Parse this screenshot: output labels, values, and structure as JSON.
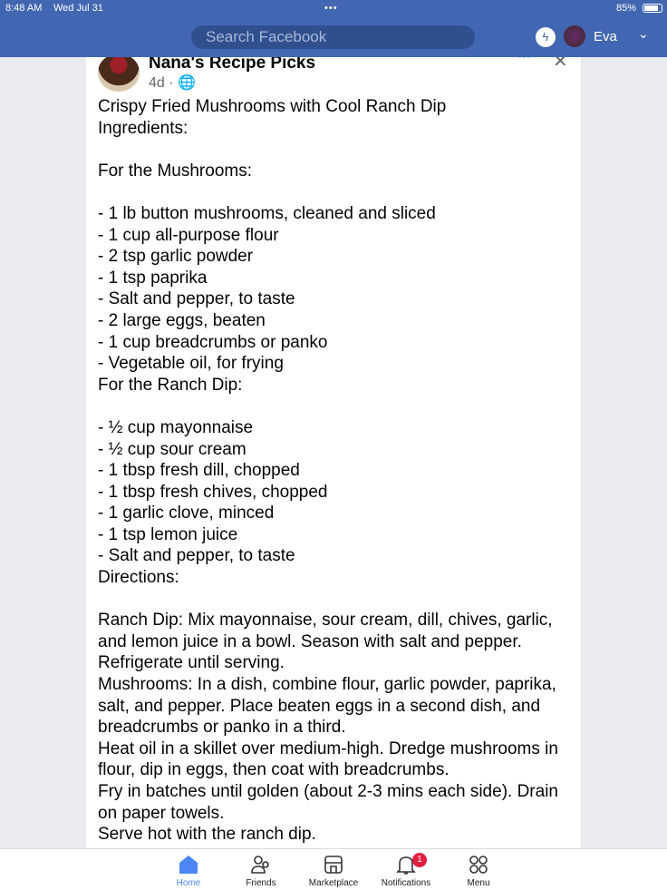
{
  "status": {
    "time": "8:48 AM",
    "date": "Wed Jul 31",
    "battery": "85%"
  },
  "header": {
    "search_placeholder": "Search Facebook",
    "user": "Eva"
  },
  "post": {
    "page_name": "Nana's Recipe Picks",
    "age": "4d ·",
    "lines": [
      "Crispy Fried Mushrooms with Cool Ranch Dip",
      "Ingredients:",
      "",
      "For the Mushrooms:",
      "",
      "- 1 lb button mushrooms, cleaned and sliced",
      "- 1 cup all-purpose flour",
      "- 2 tsp garlic powder",
      "- 1 tsp paprika",
      "- Salt and pepper, to taste",
      "- 2 large eggs, beaten",
      "- 1 cup breadcrumbs or panko",
      "- Vegetable oil, for frying",
      "For the Ranch Dip:",
      "",
      "- ½ cup mayonnaise",
      "- ½ cup sour cream",
      "- 1 tbsp fresh dill, chopped",
      "- 1 tbsp fresh chives, chopped",
      "- 1 garlic clove, minced",
      "- 1 tsp lemon juice",
      "- Salt and pepper, to taste",
      "Directions:",
      "",
      "Ranch Dip: Mix mayonnaise, sour cream, dill, chives, garlic,",
      "and lemon juice in a bowl. Season with salt and pepper.",
      "Refrigerate until serving.",
      "Mushrooms: In a dish, combine flour, garlic powder, paprika,",
      "salt, and pepper. Place beaten eggs in a second dish, and",
      "breadcrumbs or panko in a third.",
      "Heat oil in a skillet over medium-high. Dredge mushrooms in",
      "flour, dip in eggs, then coat with breadcrumbs.",
      "Fry in batches until golden (about 2-3 mins each side). Drain",
      "on paper towels.",
      "Serve hot with the ranch dip."
    ]
  },
  "nav": {
    "home": "Home",
    "friends": "Friends",
    "marketplace": "Marketplace",
    "notifications": "Notifications",
    "notif_count": "1",
    "menu": "Menu",
    "active_color": "#4b86f5"
  }
}
